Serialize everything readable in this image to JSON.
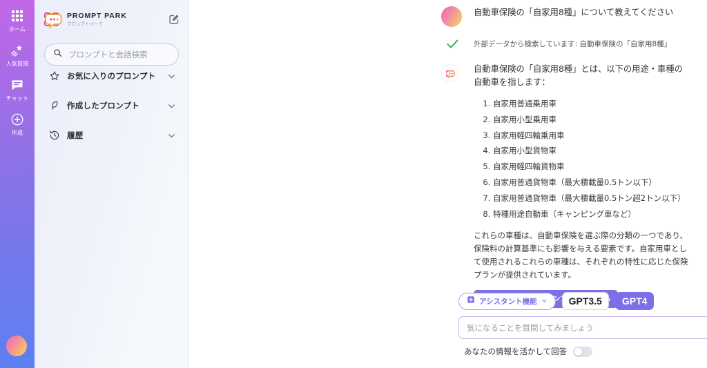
{
  "rail": {
    "items": [
      {
        "label": "ホーム",
        "icon": "grid-icon",
        "name": "home"
      },
      {
        "label": "人気質問",
        "icon": "shooting-star-icon",
        "name": "popular"
      },
      {
        "label": "チャット",
        "icon": "chat-bubble-icon",
        "name": "chat"
      },
      {
        "label": "作成",
        "icon": "plus-circle-icon",
        "name": "create"
      }
    ],
    "avatar": "user-avatar"
  },
  "sidebar": {
    "brand": {
      "title": "PROMPT PARK",
      "subtitle": "プロンプトパーク",
      "logo_icon": "prompt-park-logo",
      "compose_icon": "compose-icon"
    },
    "search": {
      "placeholder": "プロンプトと会話検索",
      "value": "",
      "icon": "search-icon"
    },
    "nav": [
      {
        "label": "お気に入りのプロンプト",
        "icon": "star-icon",
        "name": "favorite-prompts"
      },
      {
        "label": "作成したプロンプト",
        "icon": "feather-pen-icon",
        "name": "created-prompts"
      },
      {
        "label": "履歴",
        "icon": "history-clock-icon",
        "name": "history"
      }
    ]
  },
  "chat": {
    "user_message": "自動車保険の「自家用8種」について教えてください",
    "status": {
      "icon": "check-icon",
      "text": "外部データから検索しています: 自動車保険の「自家用8種」"
    },
    "assistant": {
      "intro": "自動車保険の「自家用8種」とは、以下の用途・車種の自動車を指します：",
      "list": [
        "自家用普通乗用車",
        "自家用小型乗用車",
        "自家用軽四輪乗用車",
        "自家用小型貨物車",
        "自家用軽四輪貨物車",
        "自家用普通貨物車（最大積載量0.5トン以下）",
        "自家用普通貨物車（最大積載量0.5トン超2トン以下）",
        "特種用途自動車（キャンピング車など）"
      ],
      "paragraph": "これらの車種は、自動車保険を選ぶ際の分類の一つであり、保険料の計算基準にも影響を与える要素です。自家用車として使用されるこれらの車種は、それぞれの特性に応じた保険プランが提供されています。",
      "cta_label": "質問した内容からプロンプトを作成する"
    }
  },
  "composer": {
    "assistant_chip": {
      "label": "アシスタント機能",
      "icon": "assistant-badge-icon",
      "chevron": "chevron-down-icon"
    },
    "models": [
      {
        "label": "GPT3.5",
        "active": false
      },
      {
        "label": "GPT4",
        "active": true
      }
    ],
    "input": {
      "placeholder": "気になることを質問してみましょう",
      "value": ""
    },
    "send_icon": "send-arrow-icon",
    "mic_icon": "microphone-icon",
    "toggle": {
      "label": "あなたの情報を活かして回答",
      "on": false
    }
  },
  "colors": {
    "accent_purple": "#7b70e8",
    "rail_top": "#c367e8",
    "rail_bottom": "#5b80f2",
    "check_green": "#3cb663",
    "logo_pink": "#ef3f8f",
    "logo_orange": "#f6a83c"
  }
}
